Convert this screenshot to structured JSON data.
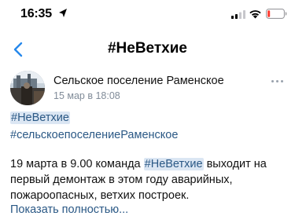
{
  "status_bar": {
    "time": "16:35",
    "icons": [
      "location-arrow-icon",
      "signal-icon",
      "wifi-icon",
      "battery-icon"
    ]
  },
  "nav": {
    "back_icon": "chevron-left-icon",
    "title": "#НеВетхие"
  },
  "post": {
    "author": "Сельское поселение Раменское",
    "date": "15 мар в 18:08",
    "tags": [
      "#НеВетхие",
      "#сельскоепоселениеРаменское"
    ],
    "text_before": "19 марта в 9.00 команда ",
    "text_tag": "#НеВетхие",
    "text_after": " выходит на первый демонтаж в этом году аварийных, пожароопасных, ветхих построек.",
    "show_more": "Показать полностью..."
  },
  "colors": {
    "link": "#2a5885",
    "accent": "#2688eb",
    "secondary_text": "#818c99",
    "highlight": "#dbe6f3"
  }
}
